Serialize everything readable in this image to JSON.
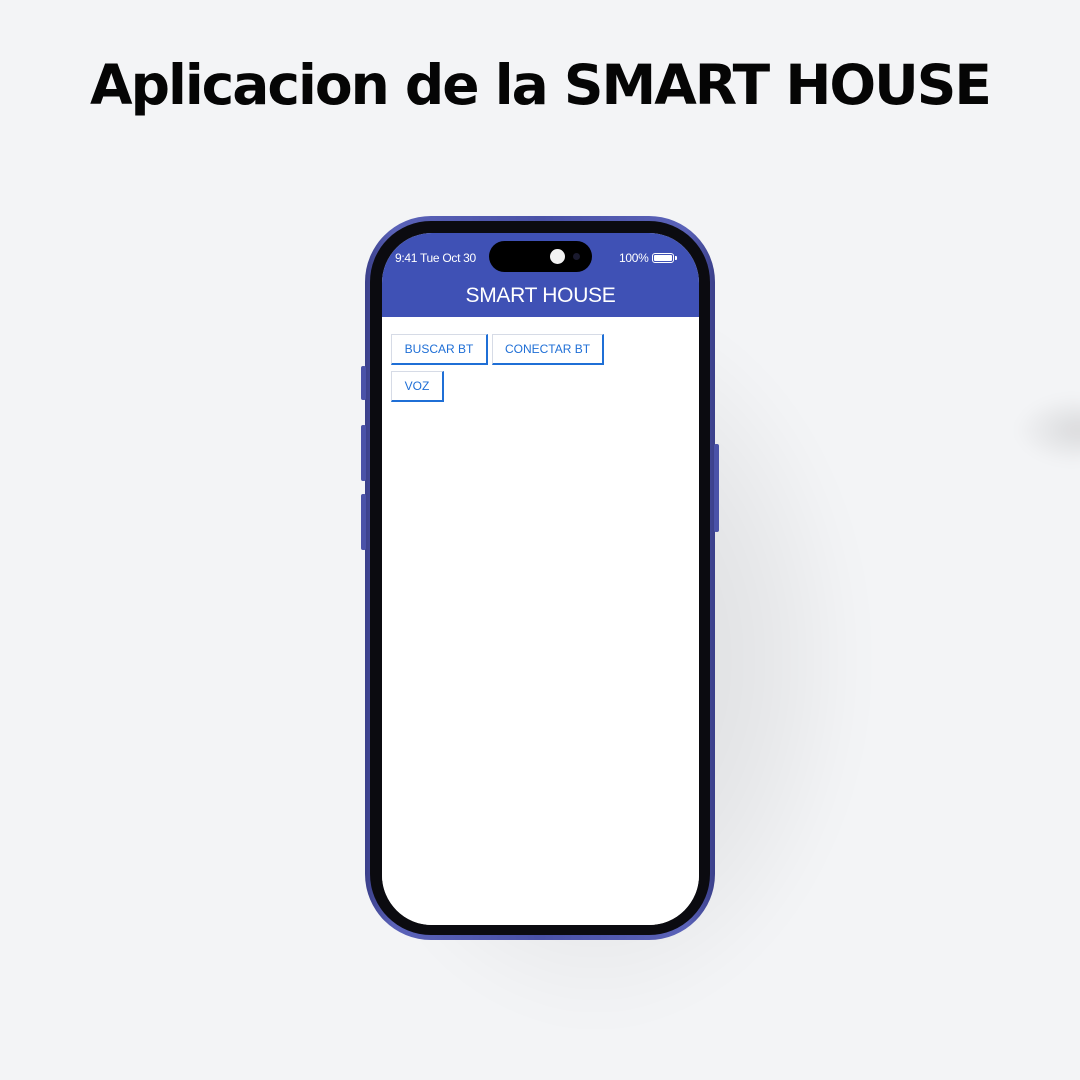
{
  "page": {
    "heading": "Aplicacion de la SMART HOUSE"
  },
  "device": {
    "frame_color": "#4a52a8",
    "status_bar": {
      "time": "9:41 Tue Oct 30",
      "battery": "100%",
      "battery_icon": "battery-full-icon"
    }
  },
  "app": {
    "header_color": "#3f51b5",
    "title": "SMART HOUSE",
    "buttons": {
      "search_bt": "BUSCAR BT",
      "connect_bt": "CONECTAR BT",
      "voice": "VOZ"
    },
    "button_text_color": "#1f6fd6"
  }
}
